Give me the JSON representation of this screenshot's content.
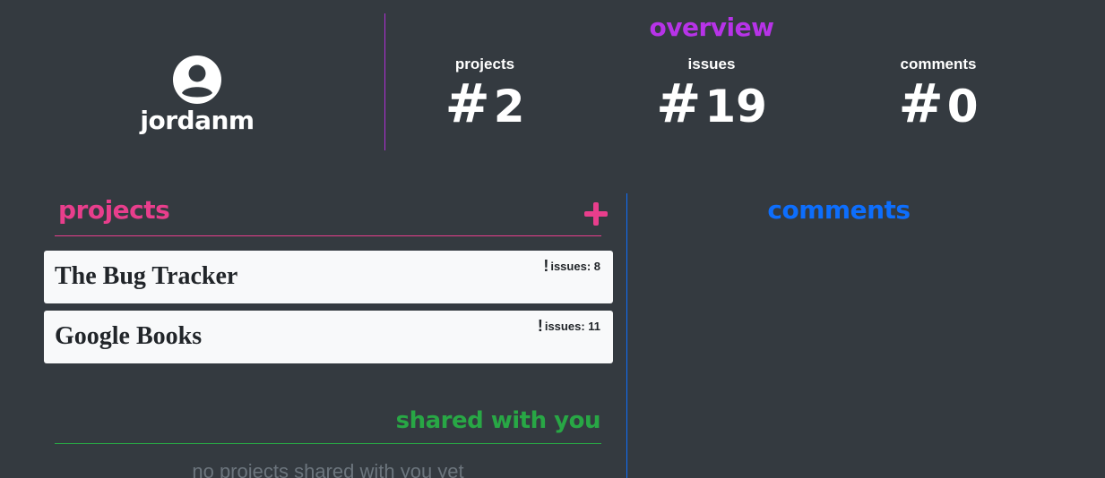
{
  "profile": {
    "username": "jordanm",
    "avatar_icon": "user-circle-icon"
  },
  "overview": {
    "title": "overview",
    "stats": [
      {
        "label": "projects",
        "symbol": "#",
        "value": "2"
      },
      {
        "label": "issues",
        "symbol": "#",
        "value": "19"
      },
      {
        "label": "comments",
        "symbol": "#",
        "value": "0"
      }
    ]
  },
  "projects": {
    "title": "projects",
    "add_icon": "plus-icon",
    "items": [
      {
        "name": "The Bug Tracker",
        "issues_label": "issues: 8"
      },
      {
        "name": "Google Books",
        "issues_label": "issues: 11"
      }
    ]
  },
  "shared": {
    "title": "shared with you",
    "empty_text": "no projects shared with you yet"
  },
  "comments": {
    "title": "comments"
  },
  "colors": {
    "background": "#343a40",
    "overview_accent": "#b733e8",
    "projects_accent": "#e83e8c",
    "shared_accent": "#28a745",
    "comments_accent": "#0d6efd",
    "card_background": "#f8f9fa"
  }
}
